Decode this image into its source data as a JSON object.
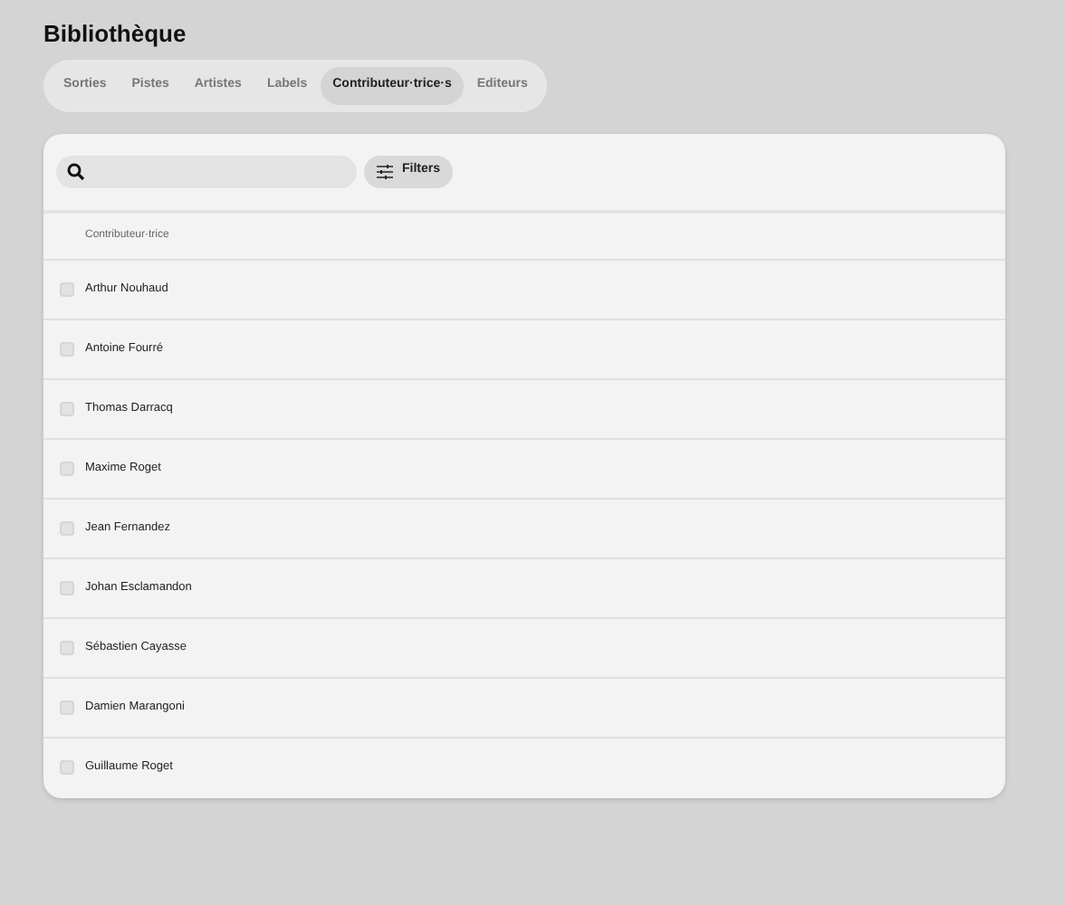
{
  "title": "Bibliothèque",
  "tabs": [
    {
      "label": "Sorties",
      "selected": false
    },
    {
      "label": "Pistes",
      "selected": false
    },
    {
      "label": "Artistes",
      "selected": false
    },
    {
      "label": "Labels",
      "selected": false
    },
    {
      "label": "Contributeur·trice·s",
      "selected": true
    },
    {
      "label": "Editeurs",
      "selected": false
    }
  ],
  "filters_button": "Filters",
  "table": {
    "columns": [
      "Contributeur·trice"
    ],
    "rows": [
      {
        "name": "Arthur Nouhaud",
        "checked": false
      },
      {
        "name": "Antoine Fourré",
        "checked": false
      },
      {
        "name": "Thomas Darracq",
        "checked": false
      },
      {
        "name": "Maxime Roget",
        "checked": false
      },
      {
        "name": "Jean Fernandez",
        "checked": false
      },
      {
        "name": "Johan Esclamandon",
        "checked": false
      },
      {
        "name": "Sébastien Cayasse",
        "checked": false
      },
      {
        "name": "Damien Marangoni",
        "checked": false
      },
      {
        "name": "Guillaume Roget",
        "checked": false
      }
    ]
  }
}
